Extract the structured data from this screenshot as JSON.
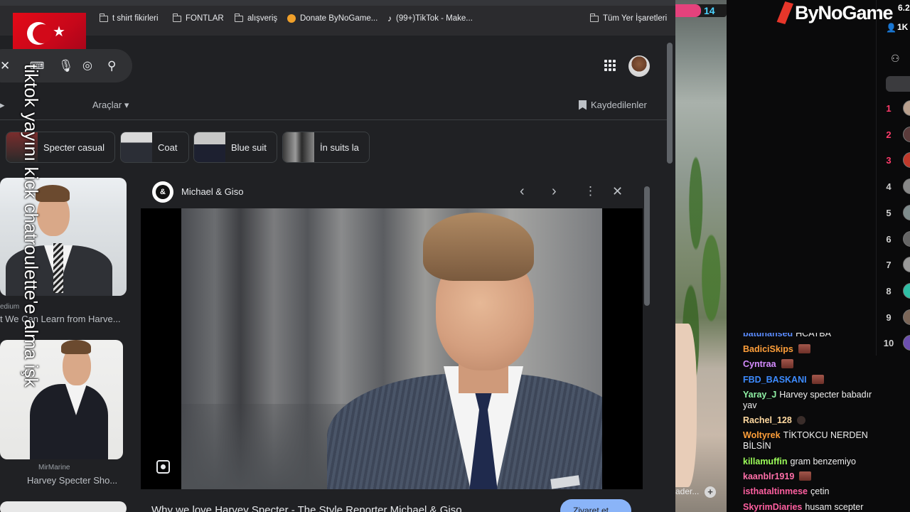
{
  "bookmarks": [
    {
      "label": "t shirt fikirleri",
      "icon": "folder-icon"
    },
    {
      "label": "FONTLAR",
      "icon": "folder-icon"
    },
    {
      "label": "alışveriş",
      "icon": "folder-icon"
    },
    {
      "label": "Donate ByNoGame...",
      "icon": "bynogame-favicon"
    },
    {
      "label": "(99+)TikTok - Make...",
      "icon": "tiktok-icon"
    },
    {
      "label": "Tüm Yer İşaretleri",
      "icon": "folder-icon"
    }
  ],
  "toolbar": {
    "tools_label": "Araçlar",
    "tools_arrow": "▾",
    "saved_label": "Kaydedilenler"
  },
  "chips": [
    {
      "label": "Specter casual"
    },
    {
      "label": "Coat"
    },
    {
      "label": "Blue suit"
    },
    {
      "label": "İn suits la"
    }
  ],
  "results": [
    {
      "source": "edium",
      "title": "t We Can Learn from Harve..."
    },
    {
      "source": "MirMarine",
      "title": "Harvey Specter Sho..."
    }
  ],
  "preview": {
    "source": "Michael & Giso",
    "logo_text": "&",
    "title": "Why we love Harvey Specter - The Style Reporter Michael & Giso",
    "visit_label": "Ziyaret et"
  },
  "overlay_text": "tiktok yayını kick chatroulette'e alma işk",
  "camera": {
    "badge_count": "14",
    "caption": "ader..."
  },
  "stream": {
    "brand": "ByNoGame",
    "stat1": "6.2",
    "stat2": "1K",
    "leaderboard": [
      {
        "rank": "1",
        "color": "#ff3b6b"
      },
      {
        "rank": "2",
        "color": "#ff3b6b"
      },
      {
        "rank": "3",
        "color": "#ff3b6b"
      },
      {
        "rank": "4",
        "color": "#cfcfcf"
      },
      {
        "rank": "5",
        "color": "#cfcfcf"
      },
      {
        "rank": "6",
        "color": "#cfcfcf"
      },
      {
        "rank": "7",
        "color": "#cfcfcf"
      },
      {
        "rank": "8",
        "color": "#cfcfcf"
      },
      {
        "rank": "9",
        "color": "#cfcfcf"
      },
      {
        "rank": "10",
        "color": "#cfcfcf"
      }
    ],
    "chat": [
      {
        "user": "batuhansed",
        "text": "HCATBA",
        "color": "#5b8cff",
        "cut": true
      },
      {
        "user": "BadiciSkips",
        "text": "",
        "color": "#ff9f3a",
        "emote": "emote"
      },
      {
        "user": "Cyntraa",
        "text": "",
        "color": "#d58cff",
        "emote": "emote"
      },
      {
        "user": "FBD_BASKANI",
        "text": "",
        "color": "#3d8bff",
        "emote": "emote"
      },
      {
        "user": "Yaray_J",
        "text": "Harvey specter babadır yav",
        "color": "#8ff0a4"
      },
      {
        "user": "Rachel_128",
        "text": "",
        "color": "#ffd9a0",
        "emote": "emote-dark"
      },
      {
        "user": "Woltyrek",
        "text": "TİKTOKCU NERDEN BİLSİN",
        "color": "#ff9f3a"
      },
      {
        "user": "killamuffin",
        "text": "gram benzemiyo",
        "color": "#9dff5a"
      },
      {
        "user": "kaanblr1919",
        "text": "",
        "color": "#ff6fa8",
        "emote": "emote"
      },
      {
        "user": "isthataltinmese",
        "text": "çetin",
        "color": "#ff5fa0"
      },
      {
        "user": "SkyrimDiaries",
        "text": "husam scepter",
        "color": "#ff5fa0"
      }
    ]
  },
  "colors": {
    "accent_blue": "#8ab4f8",
    "page_bg": "#202124",
    "chat_bg": "#0a0a0b",
    "brand_red": "#e7362a"
  }
}
